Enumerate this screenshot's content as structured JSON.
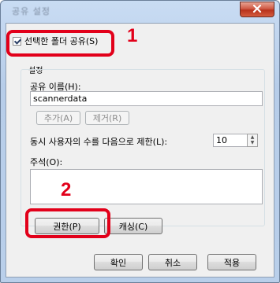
{
  "window": {
    "title": "공유 설정",
    "close_symbol": "x"
  },
  "share": {
    "checkbox_label": "선택한 폴더 공유(S)",
    "checked": true
  },
  "settings": {
    "group_label": "설정",
    "share_name_label": "공유 이름(H):",
    "share_name_value": "scannerdata",
    "add_button": "추가(A)",
    "remove_button": "제거(R)",
    "limit_label": "동시 사용자의 수를 다음으로 제한(L):",
    "limit_value": "10",
    "comment_label": "주석(O):",
    "comment_value": "",
    "permissions_button": "권한(P)",
    "caching_button": "캐싱(C)"
  },
  "footer": {
    "ok_button": "확인",
    "cancel_button": "취소",
    "apply_button": "적용"
  },
  "callouts": {
    "one": "1",
    "two": "2"
  },
  "colors": {
    "callout_red": "#e2001a",
    "title_gradient": "#b9cfea"
  }
}
